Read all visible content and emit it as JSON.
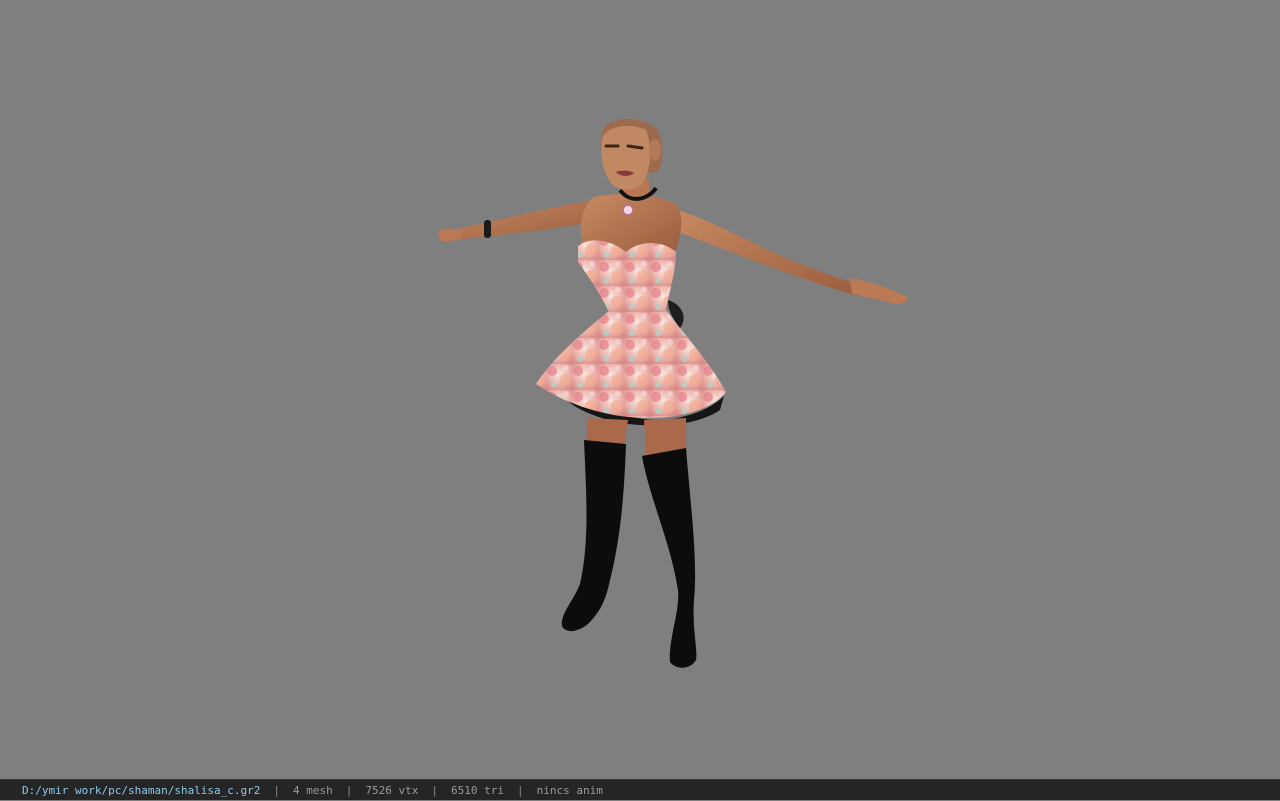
{
  "status_bar": {
    "file_path": "D:/ymir work/pc/shaman/shalisa_c.gr2",
    "mesh": "4 mesh",
    "vertices": "7526 vtx",
    "triangles": "6510 tri",
    "animation": "nincs anim",
    "separator": "|"
  },
  "colors": {
    "viewport_background": "#7f7f7f",
    "status_bar_background": "#252525",
    "path_text": "#8ec8e6",
    "info_text": "#9a9a9a"
  }
}
